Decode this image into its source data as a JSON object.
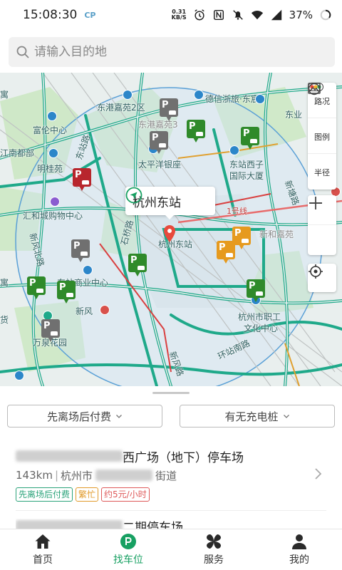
{
  "status_bar": {
    "time": "15:08:30",
    "app_badge": "CP",
    "net_speed": "0.31",
    "net_unit": "KB/S",
    "battery": "37%"
  },
  "search": {
    "placeholder": "请输入目的地"
  },
  "map": {
    "destination": "杭州东站",
    "labels": {
      "area_left_top": "寓",
      "dongang2": "东港嘉苑2区",
      "dexinzhe": "德信浙旅·东宸",
      "dongye": "东业",
      "fulun": "富伦中心",
      "dongjiangjiayuan3": "东港嘉苑3",
      "jiangnan": "江南都部",
      "shantang": "明桂苑",
      "taipingyang": "太平洋银座",
      "dongzhan_xizi": "东站西子",
      "intl_tower": "国际大厦",
      "huihe": "汇和城购物中心",
      "line1": "1号线",
      "hangzhou_station_map": "杭州东站",
      "xinhe_jiayuan": "新和嘉苑",
      "dongzhan_commercial": "东站商业中心",
      "xinfeng": "新风",
      "hangzhou_worker": "杭州市职工",
      "culture_center": "文化中心",
      "wanjia": "万泉花园",
      "huanzhan_south": "环站南路",
      "xinfeng_road": "新风路",
      "shiqiao_road": "石桥路",
      "dongzhan_road": "东站路",
      "xinfeng_north": "新风北路",
      "road_right": "新塘路",
      "yu_left": "寓",
      "huo": "货"
    },
    "tools": [
      {
        "label": "路况",
        "icon": "traffic-icon"
      },
      {
        "label": "图例",
        "icon": "legend-icon"
      },
      {
        "label": "半径",
        "icon": "radius-icon"
      }
    ]
  },
  "filters": {
    "payment": "先离场后付费",
    "charging": "有无充电桩"
  },
  "results": [
    {
      "title_visible": "西广场（地下）停车场",
      "distance": "143km",
      "city": "杭州市",
      "street": "街道",
      "tags": [
        "先离场后付费",
        "繁忙",
        "约5元/小时"
      ]
    },
    {
      "title_visible": "二期停车场"
    }
  ],
  "nav": {
    "items": [
      {
        "label": "首页",
        "icon": "home-icon"
      },
      {
        "label": "找车位",
        "icon": "parking-icon",
        "active": true
      },
      {
        "label": "服务",
        "icon": "services-icon"
      },
      {
        "label": "我的",
        "icon": "profile-icon"
      }
    ]
  },
  "colors": {
    "accent": "#17a062",
    "road": "#1fa98a",
    "park_green": "#2f8a2a",
    "park_gray": "#707070",
    "park_orange": "#e69a1e",
    "park_red": "#b8262d",
    "pin_red": "#e84a3c"
  }
}
